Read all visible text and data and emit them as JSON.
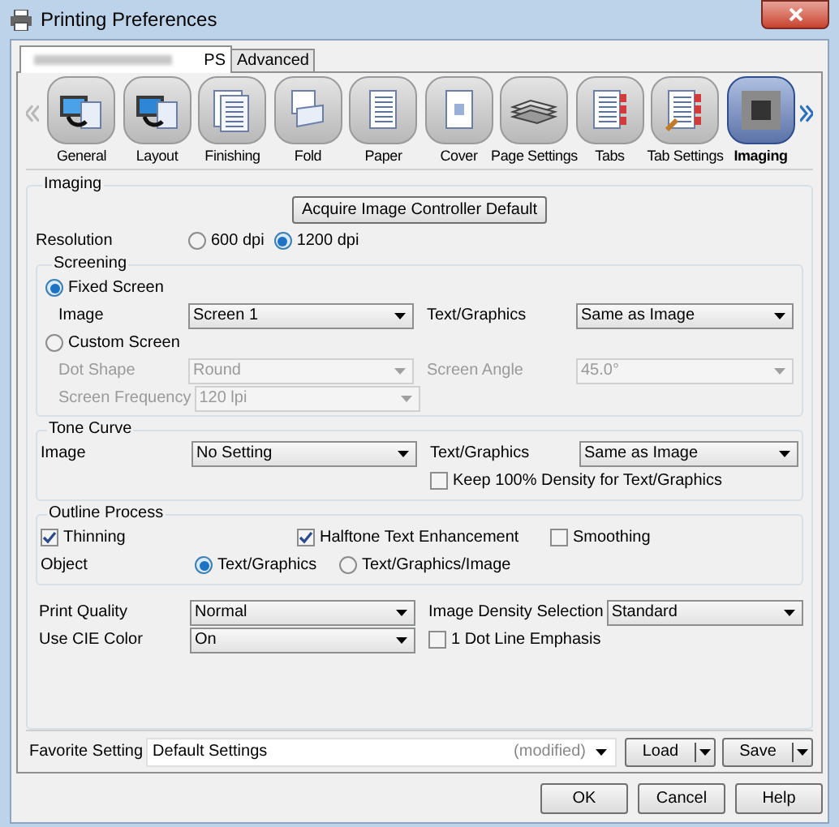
{
  "window": {
    "title": "Printing Preferences"
  },
  "tabs": [
    {
      "label": "PS",
      "selected": true
    },
    {
      "label": "Advanced",
      "selected": false
    }
  ],
  "categories": [
    {
      "label": "General",
      "selected": false
    },
    {
      "label": "Layout",
      "selected": false
    },
    {
      "label": "Finishing",
      "selected": false
    },
    {
      "label": "Fold",
      "selected": false
    },
    {
      "label": "Paper",
      "selected": false
    },
    {
      "label": "Cover",
      "selected": false
    },
    {
      "label": "Page Settings",
      "selected": false
    },
    {
      "label": "Tabs",
      "selected": false
    },
    {
      "label": "Tab Settings",
      "selected": false
    },
    {
      "label": "Imaging",
      "selected": true
    }
  ],
  "imaging": {
    "title": "Imaging",
    "acquire_button": "Acquire Image Controller Default",
    "resolution": {
      "label": "Resolution",
      "options": [
        {
          "label": "600 dpi",
          "selected": false
        },
        {
          "label": "1200 dpi",
          "selected": true
        }
      ]
    },
    "screening": {
      "title": "Screening",
      "fixed_screen": {
        "label": "Fixed Screen",
        "selected": true
      },
      "fixed_rows": [
        {
          "label": "Image",
          "value": "Screen 1",
          "disabled": false,
          "right_label": "Text/Graphics",
          "right_value": "Same as Image"
        }
      ],
      "custom_screen": {
        "label": "Custom Screen",
        "selected": false
      },
      "custom_rows": [
        {
          "label": "Dot Shape",
          "value": "Round",
          "disabled": true,
          "right_label": "Screen Angle",
          "right_value": "45.0°"
        },
        {
          "label": "Screen Frequency",
          "value": "120 lpi",
          "disabled": true
        }
      ]
    },
    "tone_curve": {
      "title": "Tone Curve",
      "row": {
        "label": "Image",
        "value": "No Setting",
        "disabled": false,
        "right_label": "Text/Graphics",
        "right_value": "Same as Image"
      },
      "keep_density": {
        "label": "Keep 100% Density for Text/Graphics",
        "checked": false
      }
    },
    "outline_process": {
      "title": "Outline Process",
      "checks": [
        {
          "label": "Thinning",
          "checked": true
        },
        {
          "label": "Halftone Text Enhancement",
          "checked": true
        },
        {
          "label": "Smoothing",
          "checked": false
        }
      ],
      "object": {
        "label": "Object",
        "options": [
          {
            "label": "Text/Graphics",
            "selected": true
          },
          {
            "label": "Text/Graphics/Image",
            "selected": false
          }
        ]
      }
    },
    "print_quality": {
      "label": "Print Quality",
      "value": "Normal",
      "disabled": false,
      "right_label": "Image Density Selection",
      "right_value": "Standard"
    },
    "use_cie_color": {
      "label": "Use CIE Color",
      "value": "On",
      "disabled": false
    },
    "dot_line_emphasis": {
      "label": "1 Dot Line Emphasis",
      "checked": false
    }
  },
  "favorite": {
    "label": "Favorite Setting",
    "value": "Default Settings",
    "note": "(modified)",
    "load": "Load",
    "save": "Save"
  },
  "buttons": [
    "OK",
    "Cancel",
    "Help"
  ]
}
